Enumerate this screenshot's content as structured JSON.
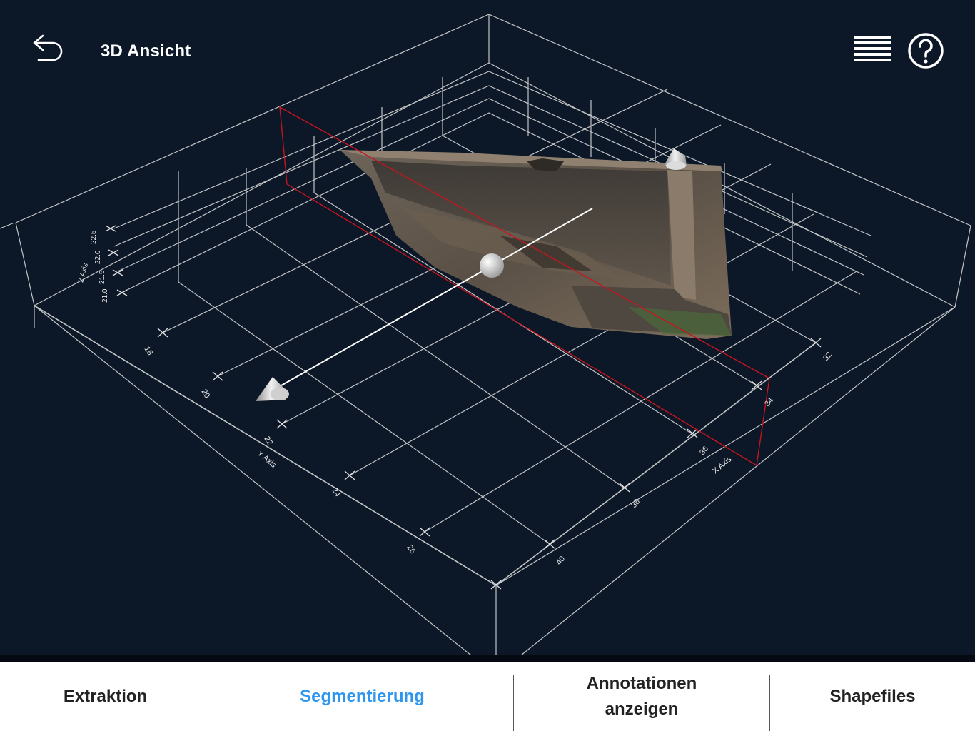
{
  "header": {
    "title": "3D Ansicht",
    "back_icon": "back-arrow-icon",
    "menu_icon": "hamburger-menu-icon",
    "help_icon": "help-question-icon"
  },
  "scene": {
    "x_axis": {
      "label": "X Axis",
      "ticks": [
        "32",
        "34",
        "36",
        "38",
        "40"
      ]
    },
    "y_axis": {
      "label": "Y Axis",
      "ticks": [
        "18",
        "20",
        "22",
        "24",
        "26"
      ]
    },
    "z_axis": {
      "label": "Z Axis",
      "ticks": [
        "21.0",
        "21.5",
        "22.0",
        "22.5"
      ]
    },
    "colors": {
      "background": "#0c1727",
      "grid": "#d8d8d8",
      "section_plane": "#c8141e",
      "accent": "#2f96f0"
    }
  },
  "tabbar": {
    "tabs": [
      {
        "label": "Extraktion",
        "active": false
      },
      {
        "label": "Segmentierung",
        "active": true
      },
      {
        "label": "Annotationen anzeigen",
        "active": false
      },
      {
        "label": "Shapefiles",
        "active": false
      }
    ]
  }
}
